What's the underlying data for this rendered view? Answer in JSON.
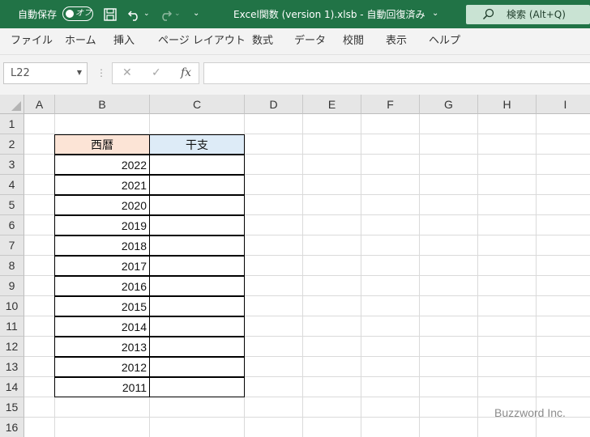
{
  "titlebar": {
    "autosave_label": "自動保存",
    "autosave_state": "オフ",
    "title": "Excel関数 (version 1).xlsb  -  自動回復済み",
    "title_dropdown": "⌄",
    "qat_more": "⌄",
    "search_label": "検索 (Alt+Q)",
    "bg_color": "#217346"
  },
  "ribbon": {
    "tabs": [
      "ファイル",
      "ホーム",
      "挿入",
      "ページ レイアウト",
      "数式",
      "データ",
      "校閲",
      "表示",
      "ヘルプ"
    ]
  },
  "formula_bar": {
    "name_box": "L22",
    "dropdown": "▼",
    "dots": "⋮",
    "cancel": "✕",
    "enter": "✓",
    "fx": "fx",
    "formula": ""
  },
  "grid": {
    "columns": [
      "A",
      "B",
      "C",
      "D",
      "E",
      "F",
      "G",
      "H",
      "I"
    ],
    "rows": [
      "1",
      "2",
      "3",
      "4",
      "5",
      "6",
      "7",
      "8",
      "9",
      "10",
      "11",
      "12",
      "13",
      "14",
      "15",
      "16"
    ]
  },
  "table": {
    "header_b": "西暦",
    "header_c": "干支",
    "header_b_color": "#fce4d6",
    "header_c_color": "#ddebf7",
    "years": [
      "2022",
      "2021",
      "2020",
      "2019",
      "2018",
      "2017",
      "2016",
      "2015",
      "2014",
      "2013",
      "2012",
      "2011"
    ]
  },
  "watermark": "Buzzword Inc."
}
